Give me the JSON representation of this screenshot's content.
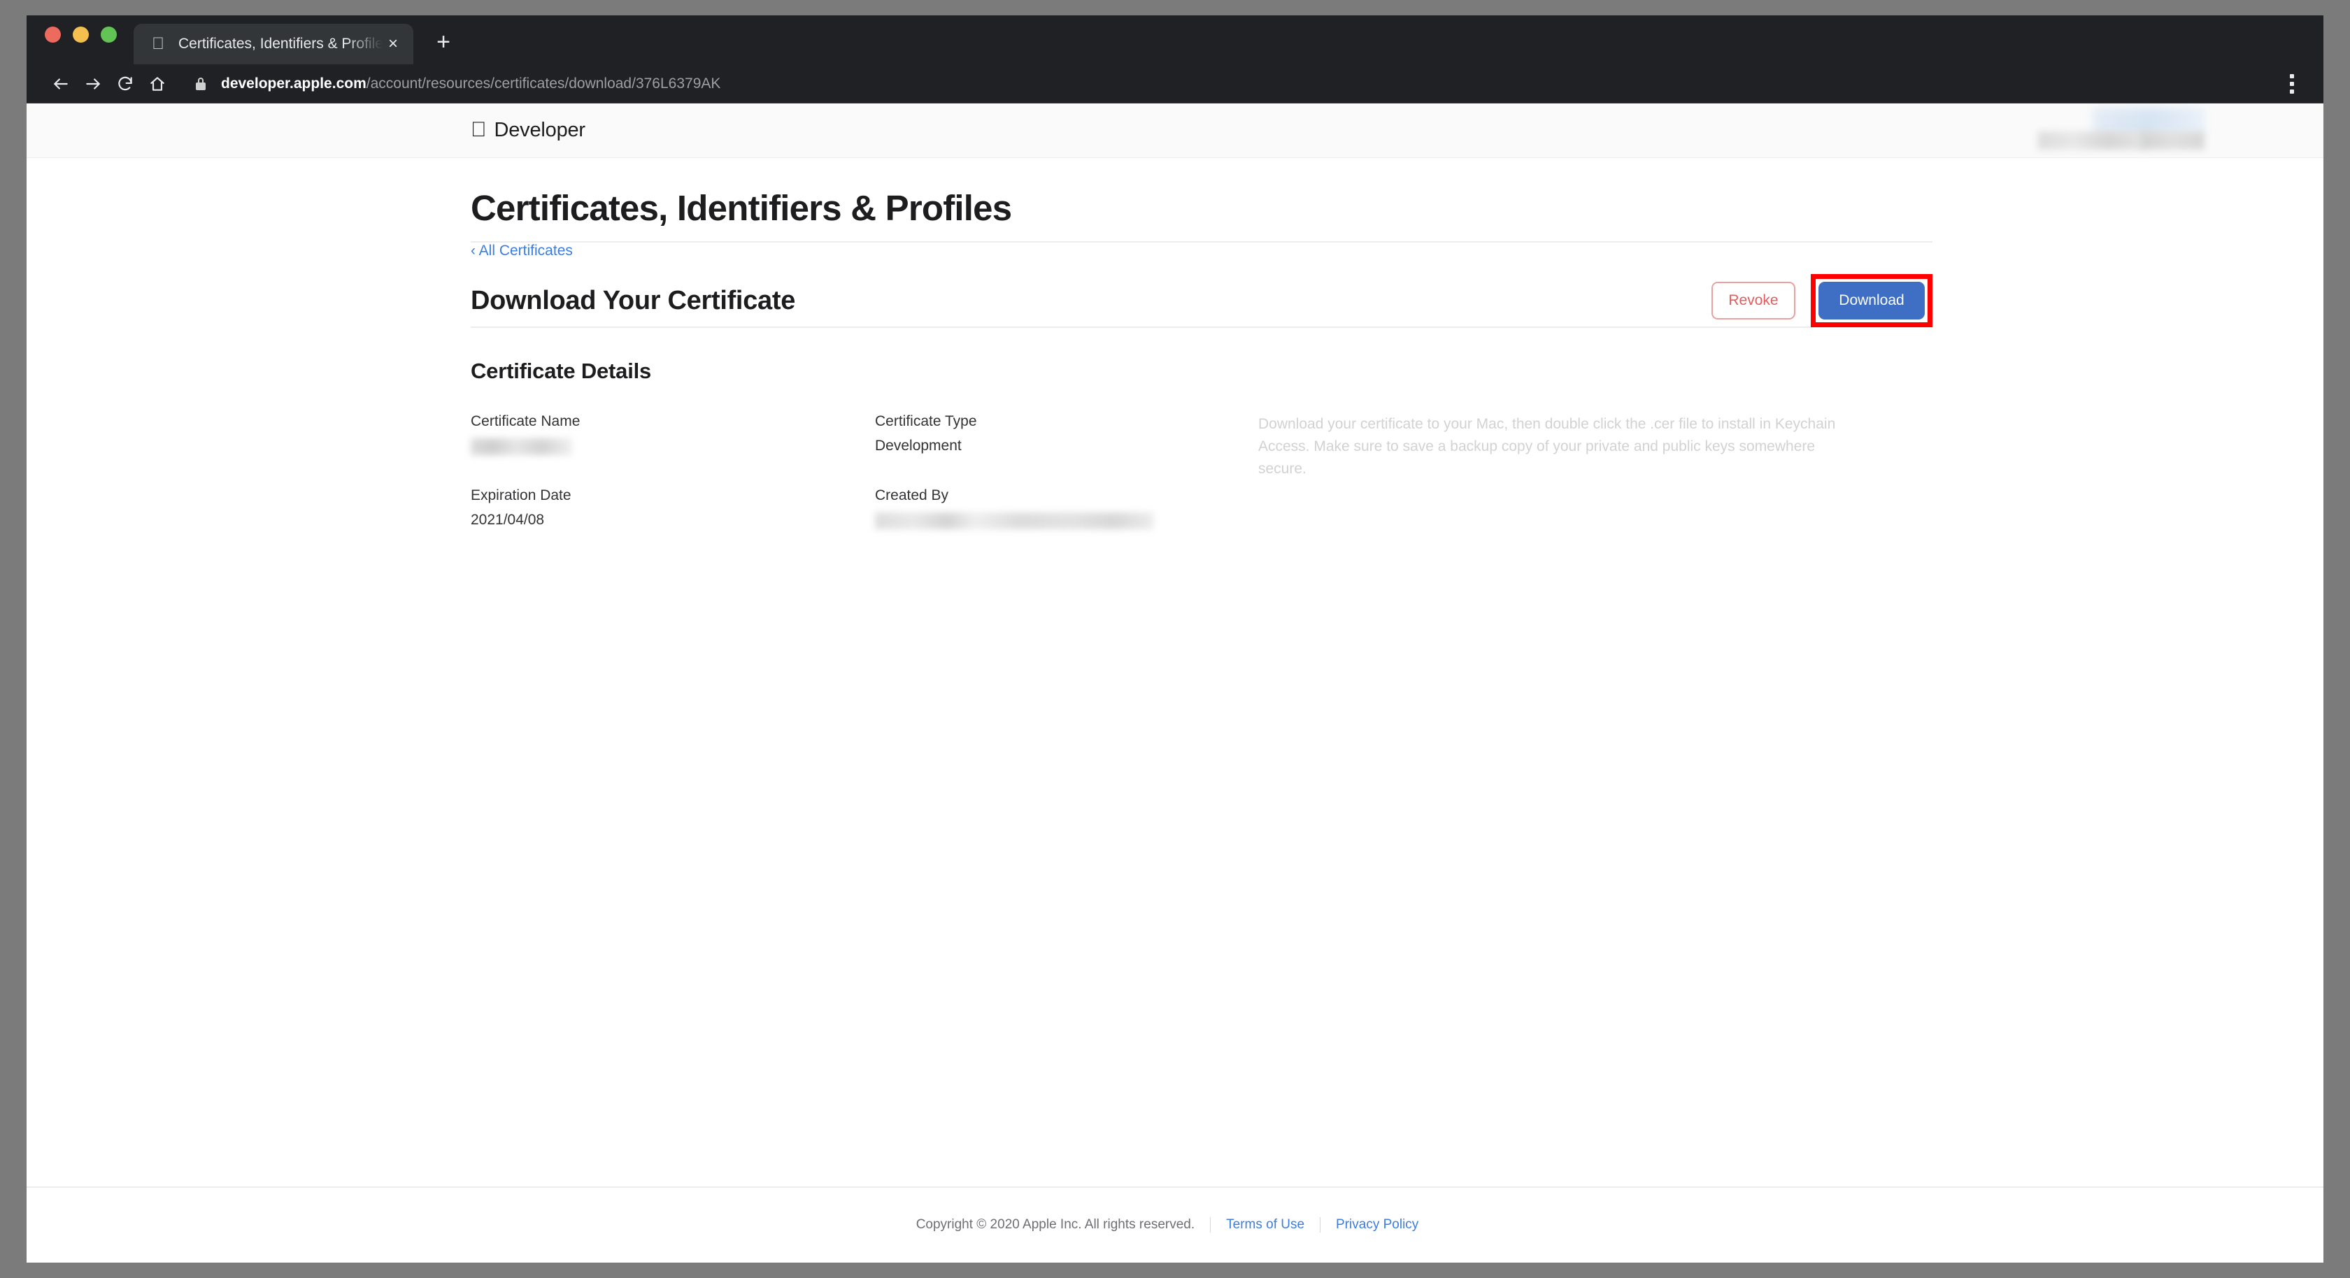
{
  "browser": {
    "tab": {
      "title": "Certificates, Identifiers & Profiles",
      "favicon": "apple-icon",
      "close_label": "×"
    },
    "new_tab_label": "+",
    "nav": {
      "back": "back-arrow-icon",
      "forward": "forward-arrow-icon",
      "reload": "reload-icon",
      "home": "home-icon"
    },
    "omnibox": {
      "lock": "lock-icon",
      "host": "developer.apple.com",
      "path": "/account/resources/certificates/download/376L6379AK"
    },
    "menu_label": "three-dot-menu-icon"
  },
  "site": {
    "brand_apple": "",
    "brand_word": "Developer"
  },
  "page": {
    "title": "Certificates, Identifiers & Profiles",
    "breadcrumb": "‹ All Certificates",
    "section_title": "Download Your Certificate",
    "actions": {
      "revoke_label": "Revoke",
      "download_label": "Download"
    },
    "details_title": "Certificate Details",
    "fields": [
      {
        "label": "Certificate Name",
        "value": "",
        "redacted": true
      },
      {
        "label": "Certificate Type",
        "value": "Development",
        "redacted": false
      },
      {
        "label": "Expiration Date",
        "value": "2021/04/08",
        "redacted": false
      },
      {
        "label": "Created By",
        "value": "",
        "redacted": true
      }
    ],
    "note": "Download your certificate to your Mac, then double click the .cer file to install in Keychain Access. Make sure to save a backup copy of your private and public keys somewhere secure."
  },
  "footer": {
    "copyright": "Copyright © 2020 Apple Inc. All rights reserved.",
    "terms_label": "Terms of Use",
    "privacy_label": "Privacy Policy"
  },
  "colors": {
    "accent_blue": "#3e6fc4",
    "link_blue": "#3b7de0",
    "revoke_red": "#e35d5d",
    "annotation_red": "#ff0000",
    "chrome_dark": "#202124"
  }
}
